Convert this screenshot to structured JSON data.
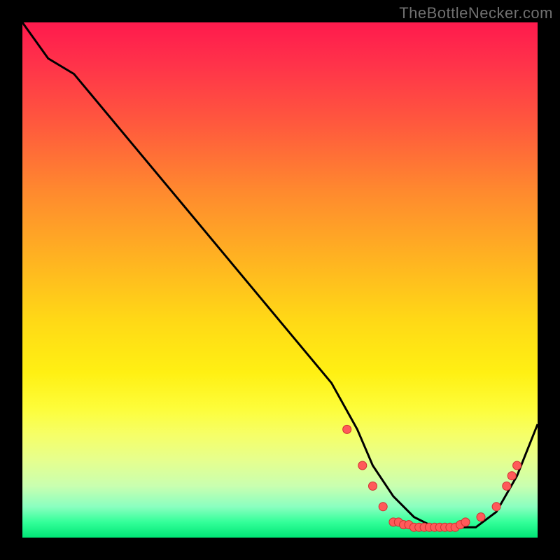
{
  "watermark": "TheBottleNecker.com",
  "chart_data": {
    "type": "line",
    "title": "",
    "xlabel": "",
    "ylabel": "",
    "xlim": [
      0,
      100
    ],
    "ylim": [
      0,
      100
    ],
    "series": [
      {
        "name": "curve",
        "x": [
          0,
          5,
          10,
          20,
          30,
          40,
          50,
          60,
          65,
          68,
          72,
          76,
          80,
          84,
          88,
          92,
          96,
          100
        ],
        "y": [
          100,
          93,
          90,
          78,
          66,
          54,
          42,
          30,
          21,
          14,
          8,
          4,
          2,
          2,
          2,
          5,
          12,
          22
        ]
      }
    ],
    "markers": {
      "name": "dots",
      "color": "#ff5a5a",
      "points": [
        {
          "x": 63,
          "y": 21
        },
        {
          "x": 66,
          "y": 14
        },
        {
          "x": 68,
          "y": 10
        },
        {
          "x": 70,
          "y": 6
        },
        {
          "x": 72,
          "y": 3
        },
        {
          "x": 73,
          "y": 3
        },
        {
          "x": 74,
          "y": 2.5
        },
        {
          "x": 75,
          "y": 2.5
        },
        {
          "x": 76,
          "y": 2
        },
        {
          "x": 77,
          "y": 2
        },
        {
          "x": 78,
          "y": 2
        },
        {
          "x": 79,
          "y": 2
        },
        {
          "x": 80,
          "y": 2
        },
        {
          "x": 81,
          "y": 2
        },
        {
          "x": 82,
          "y": 2
        },
        {
          "x": 83,
          "y": 2
        },
        {
          "x": 84,
          "y": 2
        },
        {
          "x": 85,
          "y": 2.5
        },
        {
          "x": 86,
          "y": 3
        },
        {
          "x": 89,
          "y": 4
        },
        {
          "x": 92,
          "y": 6
        },
        {
          "x": 94,
          "y": 10
        },
        {
          "x": 95,
          "y": 12
        },
        {
          "x": 96,
          "y": 14
        }
      ]
    }
  }
}
